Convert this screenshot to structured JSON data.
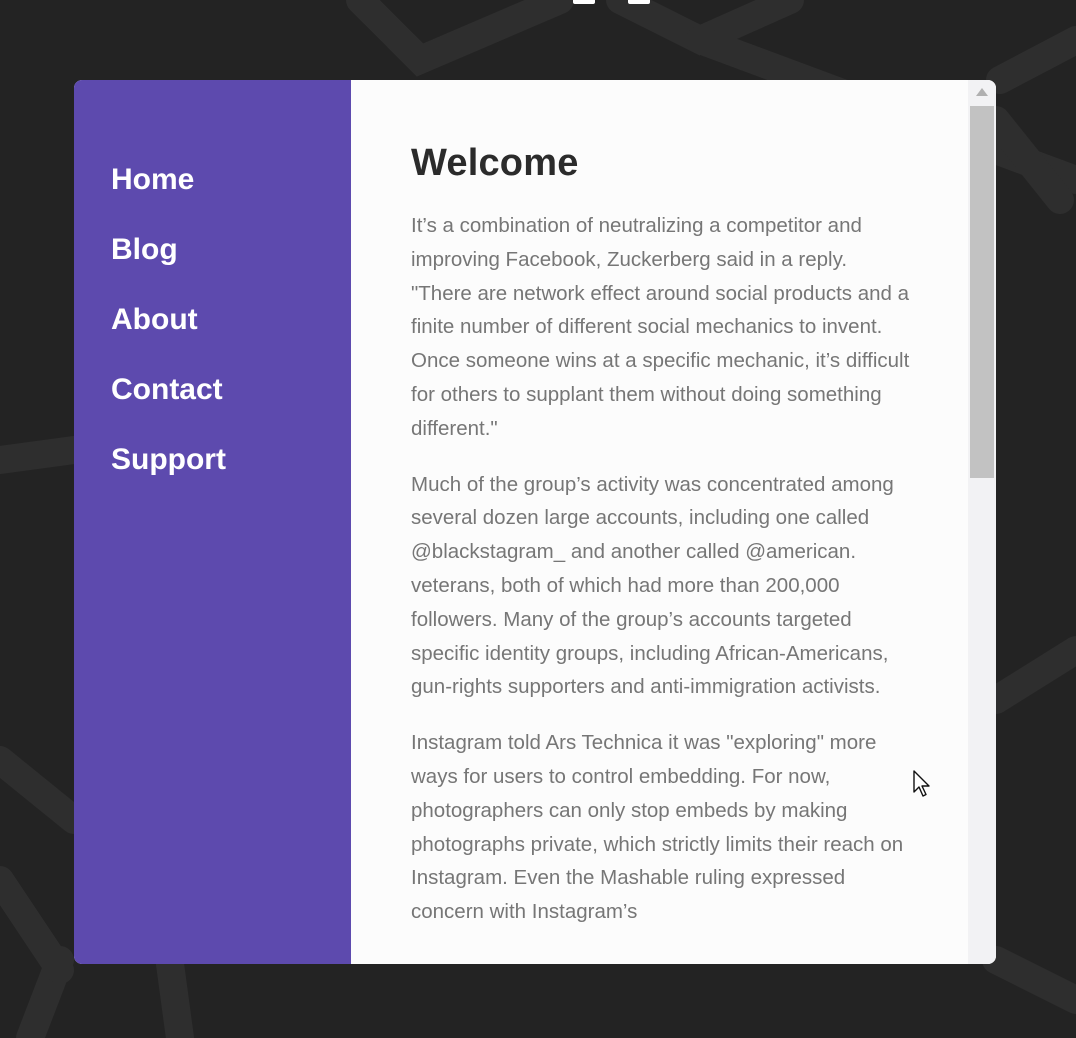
{
  "colors": {
    "background": "#232323",
    "sidebar": "#5d4aae",
    "content_bg": "#fcfcfc",
    "heading": "#2b2b2b",
    "body_text": "#767676"
  },
  "sidebar": {
    "items": [
      {
        "label": "Home"
      },
      {
        "label": "Blog"
      },
      {
        "label": "About"
      },
      {
        "label": "Contact"
      },
      {
        "label": "Support"
      }
    ]
  },
  "main": {
    "title": "Welcome",
    "paragraphs": [
      "It’s a combination of neutralizing a competitor and improving Facebook, Zuckerberg said in a reply. \"There are network effect around social products and a finite number of different social mechanics to invent. Once someone wins at a specific mechanic, it’s difficult for others to supplant them without doing something different.\"",
      "Much of the group’s activity was concentrated among several dozen large accounts, including one called @blackstagram_ and another called @american. veterans, both of which had more than 200,000 followers. Many of the group’s accounts targeted specific identity groups, including African-Americans, gun-rights supporters and anti-immigration activists.",
      "Instagram told Ars Technica it was \"exploring\" more ways for users to control embedding. For now, photographers can only stop embeds by making photographs private, which strictly limits their reach on Instagram. Even the Mashable ruling expressed concern with Instagram’s"
    ]
  },
  "icons": {
    "scroll_up": "chevron-up-icon",
    "cursor": "mouse-pointer-icon"
  }
}
